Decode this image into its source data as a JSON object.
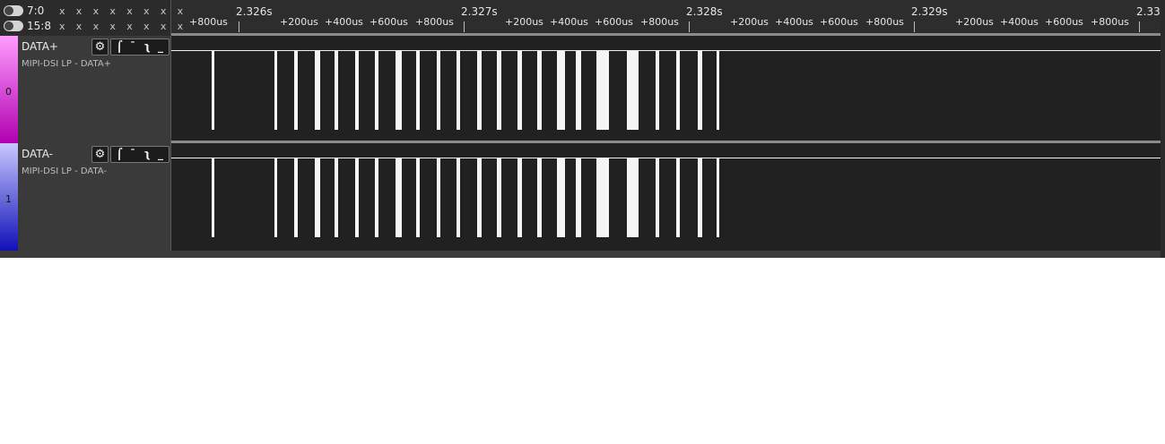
{
  "header": {
    "bus_rows": [
      {
        "label": "7:0",
        "values": "x x x x x x x x"
      },
      {
        "label": "15:8",
        "values": "x x x x x x x x"
      }
    ],
    "major_ticks": [
      "2.326s",
      "2.327s",
      "2.328s",
      "2.329s",
      "2.33"
    ],
    "minor_labels": [
      "+800us",
      "+200us",
      "+400us",
      "+600us",
      "+800us",
      "+200us",
      "+400us",
      "+600us",
      "+800us",
      "+200us",
      "+400us",
      "+600us",
      "+800us",
      "+200us",
      "+400us",
      "+600us",
      "+800us"
    ]
  },
  "channels": [
    {
      "number": "0",
      "name": "DATA+",
      "analyzer": "MIPI-DSI LP - DATA+",
      "color_top": "#ff9cff",
      "color_bottom": "#b000b0"
    },
    {
      "number": "1",
      "name": "DATA-",
      "analyzer": "MIPI-DSI LP - DATA-",
      "color_top": "#c8c8ff",
      "color_bottom": "#1010b8"
    }
  ],
  "icons": {
    "gear": "gear-icon",
    "rising": "rising-edge-trigger-icon",
    "falling": "falling-edge-trigger-icon",
    "low": "low-level-trigger-icon"
  },
  "colors": {
    "background": "#212121",
    "signal": "#f5f5f5"
  }
}
